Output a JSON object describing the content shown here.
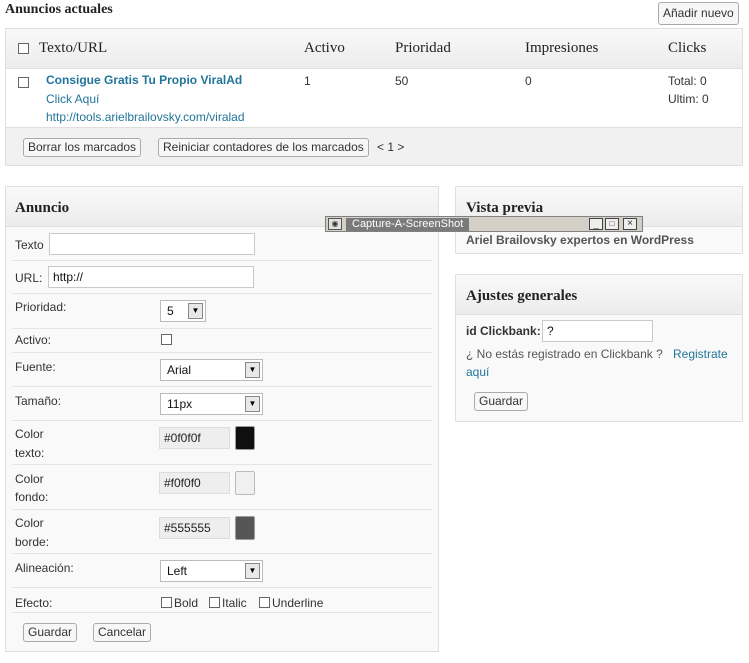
{
  "top": {
    "title": "Anuncios actuales",
    "add_new": "Añadir nuevo"
  },
  "ads_table": {
    "headers": [
      "Texto/URL",
      "Activo",
      "Prioridad",
      "Impresiones",
      "Clicks"
    ],
    "rows": [
      {
        "title": "Consigue Gratis Tu Propio ViralAd",
        "subtitle": "Click Aquí",
        "url": "http://tools.arielbrailovsky.com/viralad",
        "active": "1",
        "priority": "50",
        "impressions": "0",
        "clicks_total": "Total: 0",
        "clicks_last": "Ultim: 0"
      }
    ],
    "footer": {
      "delete_marked": "Borrar los marcados",
      "reset_counters": "Reiniciar contadores de los marcados",
      "pagination": "< 1 >"
    }
  },
  "ad_form": {
    "title": "Anuncio",
    "texto_label": "Texto",
    "texto_value": "",
    "url_label": "URL:",
    "url_value": "http://",
    "priority_label": "Prioridad:",
    "priority_value": "5",
    "active_label": "Activo:",
    "font_label": "Fuente:",
    "font_value": "Arial",
    "size_label": "Tamaño:",
    "size_value": "11px",
    "text_color_label_1": "Color",
    "text_color_label_2": "texto:",
    "text_color_value": "#0f0f0f",
    "bg_color_label_1": "Color",
    "bg_color_label_2": "fondo:",
    "bg_color_value": "#f0f0f0",
    "border_color_label_1": "Color",
    "border_color_label_2": "borde:",
    "border_color_value": "#555555",
    "align_label": "Alineación:",
    "align_value": "Left",
    "effect_label": "Efecto:",
    "effects": [
      "Bold",
      "Italic",
      "Underline"
    ],
    "save": "Guardar",
    "cancel": "Cancelar"
  },
  "preview": {
    "title": "Vista previa",
    "text": "Ariel Brailovsky expertos en WordPress"
  },
  "overlay_window": {
    "title": "Capture-A-ScreenShot",
    "icon": "camera-icon"
  },
  "settings": {
    "title": "Ajustes generales",
    "clickbank_label": "id Clickbank:",
    "clickbank_value": "?",
    "not_registered": "¿ No estás registrado en Clickbank ?",
    "register_link_1": "Registrate",
    "register_link_2": "aquí",
    "save": "Guardar"
  },
  "colors": {
    "link": "#21759b",
    "swatch_text": "#0f0f0f",
    "swatch_bg": "#f0f0f0",
    "swatch_border": "#555555"
  }
}
